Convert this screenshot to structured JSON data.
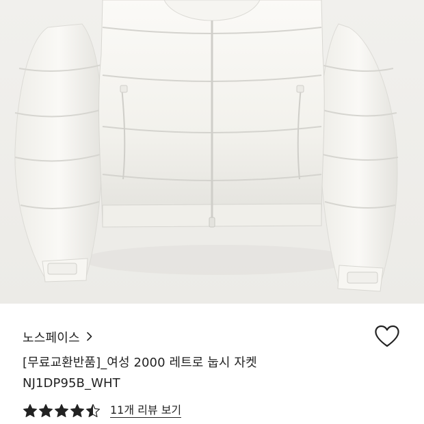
{
  "product": {
    "image_icon": "white-puffer-jacket-photo",
    "brand": "노스페이스",
    "brand_chevron_icon": "chevron-right-icon",
    "wishlist_icon": "heart-outline-icon",
    "title_line1": "[무료교환반품]_여성 2000 레트로 눕시 자켓",
    "title_line2": "NJ1DP95B_WHT",
    "rating": {
      "value": 4.5,
      "max": 5,
      "star_color": "#222222"
    },
    "review_link": "11개 리뷰 보기"
  },
  "colors": {
    "jacket": "#f3f2ee",
    "background": "#efefec",
    "text": "#222222"
  }
}
